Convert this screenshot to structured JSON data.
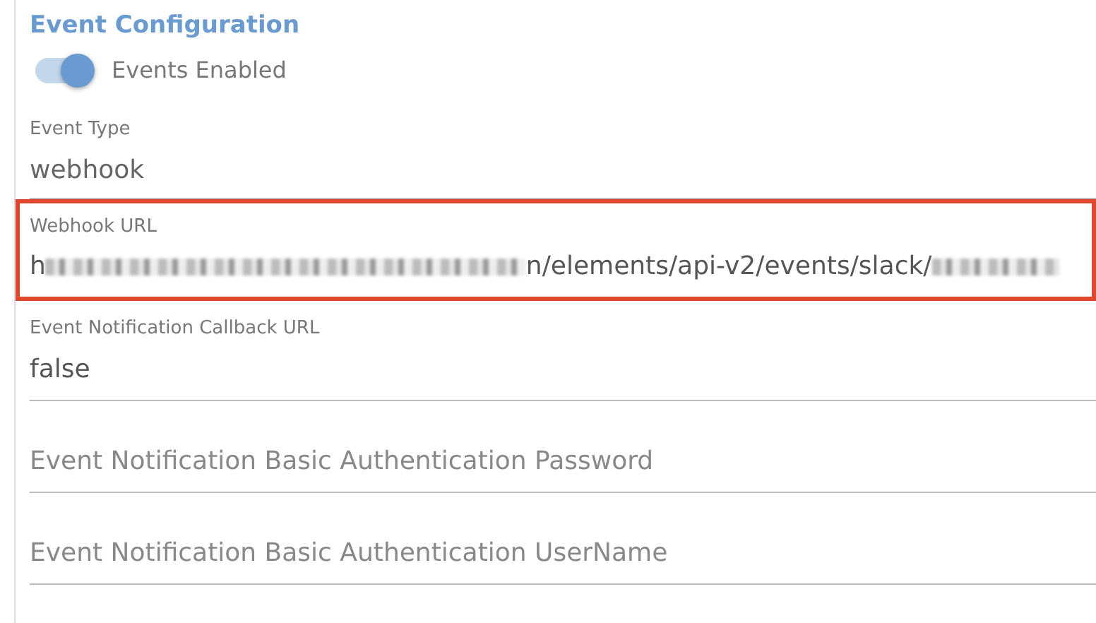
{
  "section": {
    "title": "Event Configuration"
  },
  "toggle": {
    "label": "Events Enabled",
    "on": true
  },
  "fields": [
    {
      "kind": "static",
      "label": "Event Type",
      "value": "webhook",
      "highlighted": false
    },
    {
      "kind": "redacted",
      "label": "Webhook URL",
      "highlighted": true,
      "segments": [
        {
          "kind": "text",
          "text": "h"
        },
        {
          "kind": "redacted"
        },
        {
          "kind": "text",
          "text": "n/elements/api-v2/events/slack/"
        },
        {
          "kind": "redacted"
        }
      ]
    },
    {
      "kind": "input",
      "label": "Event Notification Callback URL",
      "value": "false",
      "highlighted": false
    },
    {
      "kind": "input",
      "placeholder": "Event Notification Basic Authentication Password",
      "highlighted": false
    },
    {
      "kind": "input",
      "placeholder": "Event Notification Basic Authentication UserName",
      "highlighted": false
    }
  ]
}
